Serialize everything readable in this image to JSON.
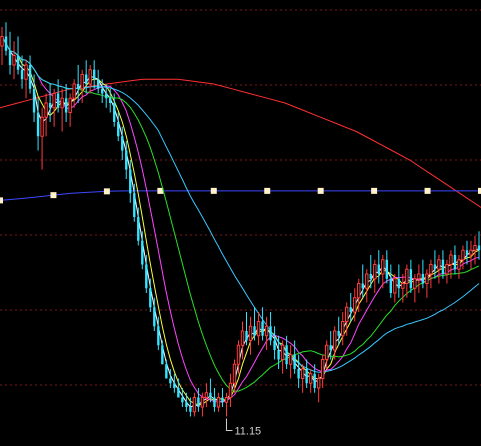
{
  "chart_data": {
    "type": "candlestick",
    "low_marker": {
      "label": "11.15",
      "index": 56
    },
    "grid": "dotted-horizontal",
    "colors": {
      "background": "#000000",
      "grid": "#7a1a1a",
      "up": "#ff3b3b",
      "down": "#33e5ff",
      "ma_white": "#ffffff",
      "ma_yellow": "#ffff3c",
      "ma_magenta": "#ff46ff",
      "ma_green": "#28e028",
      "ma_cyan": "#38c8ff",
      "ma_red": "#ff3030",
      "ma_blue": "#3c48ff",
      "ma_blue_marker": "#fff2c8"
    },
    "y_range": [
      10.2,
      19.0
    ],
    "x_count": 120,
    "candles": [
      [
        18.2,
        18.6,
        17.8,
        18.4
      ],
      [
        18.4,
        18.7,
        18.0,
        18.1
      ],
      [
        18.1,
        18.5,
        17.6,
        17.8
      ],
      [
        17.8,
        18.3,
        17.5,
        18.0
      ],
      [
        18.0,
        18.4,
        17.6,
        17.7
      ],
      [
        17.7,
        18.0,
        17.3,
        17.5
      ],
      [
        17.5,
        17.9,
        17.1,
        17.8
      ],
      [
        17.8,
        18.0,
        17.2,
        17.3
      ],
      [
        17.3,
        17.6,
        16.6,
        16.8
      ],
      [
        16.8,
        17.1,
        16.0,
        16.3
      ],
      [
        16.3,
        16.9,
        15.6,
        16.7
      ],
      [
        16.7,
        17.2,
        16.3,
        17.0
      ],
      [
        17.0,
        17.4,
        16.6,
        16.9
      ],
      [
        16.9,
        17.3,
        16.5,
        17.2
      ],
      [
        17.2,
        17.5,
        16.8,
        16.9
      ],
      [
        16.9,
        17.3,
        16.4,
        17.1
      ],
      [
        17.1,
        17.4,
        16.6,
        16.8
      ],
      [
        16.8,
        17.2,
        16.5,
        17.1
      ],
      [
        17.1,
        17.5,
        16.9,
        17.4
      ],
      [
        17.4,
        17.8,
        17.0,
        17.3
      ],
      [
        17.3,
        17.7,
        17.0,
        17.6
      ],
      [
        17.6,
        17.9,
        17.2,
        17.4
      ],
      [
        17.4,
        17.8,
        17.2,
        17.7
      ],
      [
        17.7,
        17.9,
        17.3,
        17.5
      ],
      [
        17.5,
        17.7,
        17.2,
        17.3
      ],
      [
        17.3,
        17.5,
        17.0,
        17.2
      ],
      [
        17.2,
        17.4,
        16.9,
        17.1
      ],
      [
        17.1,
        17.3,
        16.8,
        17.0
      ],
      [
        17.0,
        17.2,
        16.5,
        16.6
      ],
      [
        16.6,
        16.8,
        16.2,
        16.3
      ],
      [
        16.3,
        16.5,
        15.8,
        16.0
      ],
      [
        16.0,
        16.2,
        15.4,
        15.6
      ],
      [
        15.6,
        15.8,
        14.9,
        15.1
      ],
      [
        15.1,
        15.3,
        14.5,
        14.6
      ],
      [
        14.6,
        14.8,
        14.0,
        14.1
      ],
      [
        14.1,
        14.3,
        13.5,
        13.6
      ],
      [
        13.6,
        13.8,
        13.0,
        13.1
      ],
      [
        13.1,
        13.3,
        12.6,
        12.7
      ],
      [
        12.7,
        12.9,
        12.2,
        12.3
      ],
      [
        12.3,
        12.5,
        11.8,
        11.9
      ],
      [
        11.9,
        12.0,
        11.5,
        11.5
      ],
      [
        11.5,
        11.6,
        11.2,
        11.2
      ],
      [
        11.2,
        11.4,
        11.0,
        11.1
      ],
      [
        11.1,
        11.3,
        10.9,
        11.0
      ],
      [
        11.0,
        11.2,
        10.8,
        10.8
      ],
      [
        10.8,
        11.0,
        10.6,
        10.7
      ],
      [
        10.7,
        10.9,
        10.5,
        10.6
      ],
      [
        10.6,
        10.8,
        10.4,
        10.5
      ],
      [
        10.5,
        10.9,
        10.4,
        10.8
      ],
      [
        10.8,
        11.0,
        10.5,
        10.6
      ],
      [
        10.6,
        10.9,
        10.4,
        10.8
      ],
      [
        10.8,
        11.1,
        10.6,
        10.9
      ],
      [
        10.9,
        11.2,
        10.7,
        10.8
      ],
      [
        10.8,
        11.0,
        10.5,
        10.6
      ],
      [
        10.6,
        10.9,
        10.5,
        10.8
      ],
      [
        10.8,
        11.0,
        10.6,
        10.7
      ],
      [
        10.7,
        10.9,
        10.4,
        10.8
      ],
      [
        10.8,
        11.3,
        10.6,
        11.1
      ],
      [
        11.1,
        11.6,
        10.9,
        11.5
      ],
      [
        11.5,
        12.0,
        11.3,
        11.9
      ],
      [
        11.9,
        12.4,
        11.6,
        12.2
      ],
      [
        12.2,
        12.6,
        11.9,
        12.0
      ],
      [
        12.0,
        12.5,
        11.7,
        12.3
      ],
      [
        12.3,
        12.7,
        12.0,
        12.1
      ],
      [
        12.1,
        12.6,
        11.9,
        12.4
      ],
      [
        12.4,
        12.7,
        12.0,
        12.1
      ],
      [
        12.1,
        12.5,
        11.8,
        12.3
      ],
      [
        12.3,
        12.6,
        11.9,
        12.0
      ],
      [
        12.0,
        12.3,
        11.6,
        11.8
      ],
      [
        11.8,
        12.1,
        11.4,
        11.6
      ],
      [
        11.6,
        12.0,
        11.3,
        11.9
      ],
      [
        11.9,
        12.1,
        11.4,
        11.5
      ],
      [
        11.5,
        11.9,
        11.2,
        11.7
      ],
      [
        11.7,
        12.0,
        11.3,
        11.4
      ],
      [
        11.4,
        11.7,
        11.0,
        11.2
      ],
      [
        11.2,
        11.5,
        10.9,
        11.4
      ],
      [
        11.4,
        11.6,
        11.0,
        11.1
      ],
      [
        11.1,
        11.4,
        10.9,
        11.3
      ],
      [
        11.3,
        11.5,
        10.9,
        11.0
      ],
      [
        11.0,
        11.3,
        10.7,
        11.2
      ],
      [
        11.2,
        11.7,
        11.0,
        11.6
      ],
      [
        11.6,
        12.0,
        11.4,
        11.9
      ],
      [
        11.9,
        12.2,
        11.6,
        11.8
      ],
      [
        11.8,
        12.3,
        11.6,
        12.2
      ],
      [
        12.2,
        12.5,
        11.9,
        12.1
      ],
      [
        12.1,
        12.6,
        11.9,
        12.4
      ],
      [
        12.4,
        12.8,
        12.1,
        12.7
      ],
      [
        12.7,
        13.0,
        12.4,
        12.6
      ],
      [
        12.6,
        13.1,
        12.4,
        12.9
      ],
      [
        12.9,
        13.3,
        12.6,
        13.2
      ],
      [
        13.2,
        13.6,
        12.9,
        13.1
      ],
      [
        13.1,
        13.5,
        12.8,
        13.4
      ],
      [
        13.4,
        13.8,
        13.1,
        13.3
      ],
      [
        13.3,
        13.7,
        13.0,
        13.6
      ],
      [
        13.6,
        13.9,
        13.2,
        13.4
      ],
      [
        13.4,
        13.8,
        13.1,
        13.7
      ],
      [
        13.7,
        13.9,
        13.2,
        13.3
      ],
      [
        13.3,
        13.6,
        12.9,
        13.0
      ],
      [
        13.0,
        13.4,
        12.8,
        13.3
      ],
      [
        13.3,
        13.6,
        12.9,
        13.1
      ],
      [
        13.1,
        13.4,
        12.8,
        13.2
      ],
      [
        13.2,
        13.6,
        12.9,
        13.5
      ],
      [
        13.5,
        13.7,
        13.0,
        13.1
      ],
      [
        13.1,
        13.4,
        12.8,
        13.3
      ],
      [
        13.3,
        13.6,
        13.0,
        13.4
      ],
      [
        13.4,
        13.7,
        13.1,
        13.2
      ],
      [
        13.2,
        13.5,
        12.9,
        13.4
      ],
      [
        13.4,
        13.7,
        13.1,
        13.6
      ],
      [
        13.6,
        13.9,
        13.3,
        13.5
      ],
      [
        13.5,
        13.8,
        13.2,
        13.7
      ],
      [
        13.7,
        13.9,
        13.3,
        13.4
      ],
      [
        13.4,
        13.7,
        13.2,
        13.6
      ],
      [
        13.6,
        13.9,
        13.3,
        13.8
      ],
      [
        13.8,
        14.0,
        13.4,
        13.5
      ],
      [
        13.5,
        13.8,
        13.3,
        13.7
      ],
      [
        13.7,
        14.0,
        13.5,
        13.9
      ],
      [
        13.9,
        14.1,
        13.6,
        13.8
      ],
      [
        13.8,
        14.1,
        13.5,
        13.9
      ],
      [
        13.9,
        14.2,
        13.6,
        14.0
      ],
      [
        14.0,
        14.3,
        13.7,
        13.9
      ]
    ],
    "moving_averages": [
      {
        "color_key": "ma_yellow",
        "period": 5
      },
      {
        "color_key": "ma_white",
        "period": 3
      },
      {
        "color_key": "ma_magenta",
        "period": 10
      },
      {
        "color_key": "ma_green",
        "period": 20
      },
      {
        "color_key": "ma_cyan",
        "period": 40
      }
    ],
    "slow_lines": [
      {
        "color_key": "ma_red",
        "values": [
          16.9,
          17.0,
          17.1,
          17.2,
          17.3,
          17.35,
          17.4,
          17.45,
          17.5,
          17.5,
          17.5,
          17.45,
          17.4,
          17.3,
          17.2,
          17.1,
          17.0,
          16.85,
          16.7,
          16.55,
          16.4,
          16.2,
          16.0,
          15.8,
          15.55,
          15.3,
          15.05,
          14.8
        ]
      },
      {
        "color_key": "ma_blue",
        "values": [
          14.95,
          14.98,
          15.02,
          15.06,
          15.1,
          15.12,
          15.14,
          15.15,
          15.15,
          15.15,
          15.15,
          15.15,
          15.15,
          15.15,
          15.15,
          15.15,
          15.15,
          15.15,
          15.15,
          15.15,
          15.15,
          15.15,
          15.15,
          15.15,
          15.15,
          15.15,
          15.15,
          15.15
        ]
      }
    ]
  }
}
